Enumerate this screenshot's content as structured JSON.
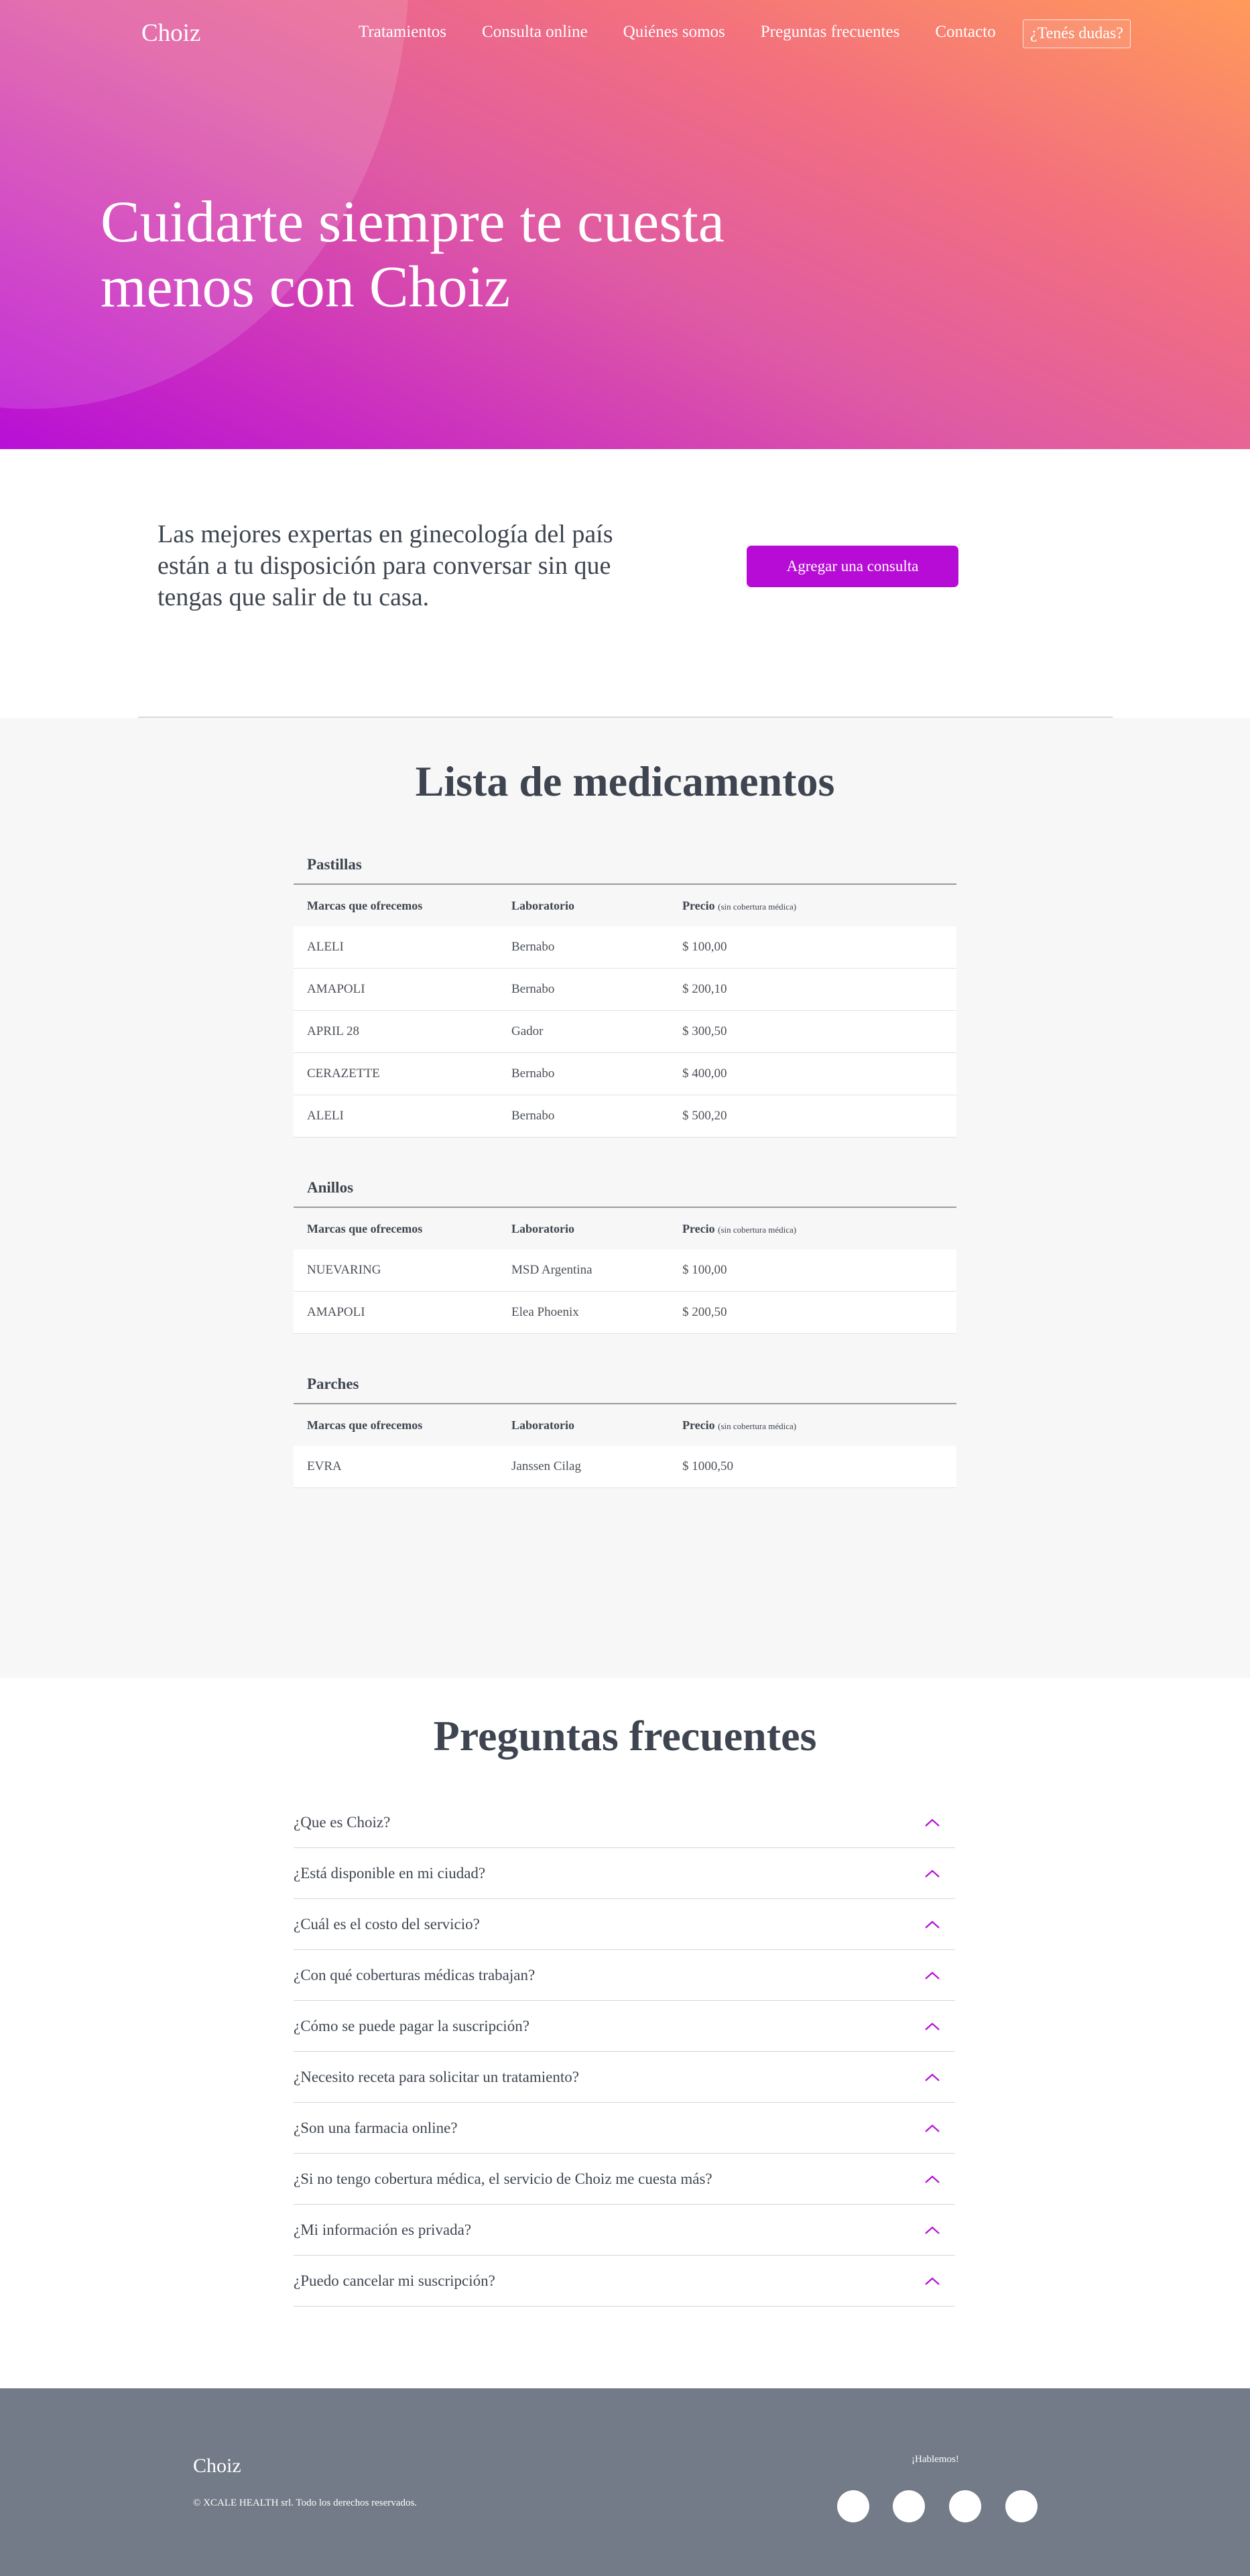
{
  "nav": {
    "logo": "Choiz",
    "links": [
      "Tratamientos",
      "Consulta online",
      "Quiénes somos",
      "Preguntas frecuentes",
      "Contacto"
    ],
    "cta": "¿Tenés dudas?"
  },
  "hero": {
    "title": "Cuidarte siempre te cuesta menos con Choiz"
  },
  "intro": {
    "text": "Las mejores expertas en ginecología del país están a tu disposición para conversar sin que tengas que salir de tu casa.",
    "button": "Agregar una consulta"
  },
  "meds": {
    "title": "Lista de medicamentos",
    "headers": {
      "brand": "Marcas que ofrecemos",
      "lab": "Laboratorio",
      "price": "Precio",
      "price_note": "(sin cobertura médica)"
    },
    "categories": [
      {
        "name": "Pastillas",
        "rows": [
          {
            "brand": "ALELI",
            "lab": "Bernabo",
            "price": "$ 100,00"
          },
          {
            "brand": "AMAPOLI",
            "lab": "Bernabo",
            "price": "$ 200,10"
          },
          {
            "brand": "APRIL 28",
            "lab": "Gador",
            "price": "$ 300,50"
          },
          {
            "brand": "CERAZETTE",
            "lab": "Bernabo",
            "price": "$ 400,00"
          },
          {
            "brand": "ALELI",
            "lab": "Bernabo",
            "price": "$ 500,20"
          }
        ]
      },
      {
        "name": "Anillos",
        "rows": [
          {
            "brand": "NUEVARING",
            "lab": "MSD Argentina",
            "price": "$ 100,00"
          },
          {
            "brand": "AMAPOLI",
            "lab": "Elea Phoenix",
            "price": "$ 200,50"
          }
        ]
      },
      {
        "name": "Parches",
        "rows": [
          {
            "brand": "EVRA",
            "lab": "Janssen Cilag",
            "price": "$ 1000,50"
          }
        ]
      }
    ]
  },
  "faq": {
    "title": "Preguntas frecuentes",
    "items": [
      "¿Que es Choiz?",
      "¿Está disponible en mi ciudad?",
      "¿Cuál es el costo del servicio?",
      "¿Con qué coberturas médicas trabajan?",
      "¿Cómo se puede pagar la suscripción?",
      "¿Necesito receta para solicitar un tratamiento?",
      "¿Son una farmacia online?",
      "¿Si no tengo cobertura médica, el servicio de Choiz me cuesta más?",
      "¿Mi información es privada?",
      "¿Puedo cancelar mi suscripción?"
    ],
    "icon": "chevron-up-icon",
    "icon_color": "#b70cd6"
  },
  "footer": {
    "logo": "Choiz",
    "copyright": "© XCALE HEALTH srl. Todo los derechos reservados.",
    "talk": "¡Hablemos!",
    "social_icons": [
      "social-icon-1",
      "social-icon-2",
      "social-icon-3",
      "social-icon-4"
    ]
  },
  "colors": {
    "accent": "#b70cd6",
    "text": "#3e4550",
    "footer_bg": "#727b87",
    "meds_bg": "#f7f7f7"
  }
}
